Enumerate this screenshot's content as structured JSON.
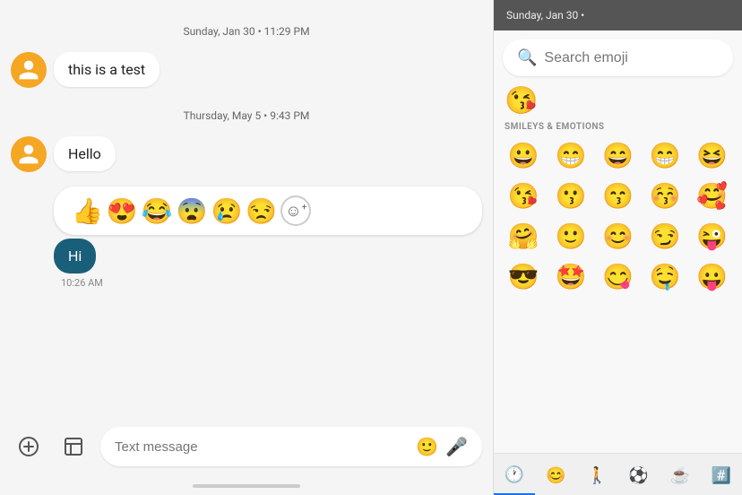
{
  "left_panel": {
    "date1": "Sunday, Jan 30 • 11:29 PM",
    "message1": "this is a test",
    "date2": "Thursday, May 5 • 9:43 PM",
    "message2": "Hello",
    "sent_message": "Hi",
    "sent_time": "10:26 AM",
    "emoji_reactions": [
      "👍",
      "😍",
      "😂",
      "😨",
      "😢",
      "😒"
    ],
    "input_placeholder": "Text message"
  },
  "right_panel": {
    "header_date": "Sunday, Jan 30 •",
    "search_placeholder": "Search emoji",
    "recent_emoji": "😘",
    "section_label": "SMILEYS & EMOTIONS",
    "emoji_rows": [
      [
        "😀",
        "😁",
        "😄",
        "😁",
        "😆"
      ],
      [
        "😘",
        "😗",
        "😙",
        "😚",
        "🥰"
      ],
      [
        "🤗",
        "🙂",
        "😊",
        "😏",
        "😜"
      ]
    ],
    "categories": [
      {
        "icon": "🕐",
        "name": "recent",
        "active": true
      },
      {
        "icon": "😊",
        "name": "smileys"
      },
      {
        "icon": "🚶",
        "name": "people"
      },
      {
        "icon": "⚽",
        "name": "activities"
      },
      {
        "icon": "☕",
        "name": "objects"
      },
      {
        "icon": "🔣",
        "name": "symbols"
      }
    ]
  }
}
